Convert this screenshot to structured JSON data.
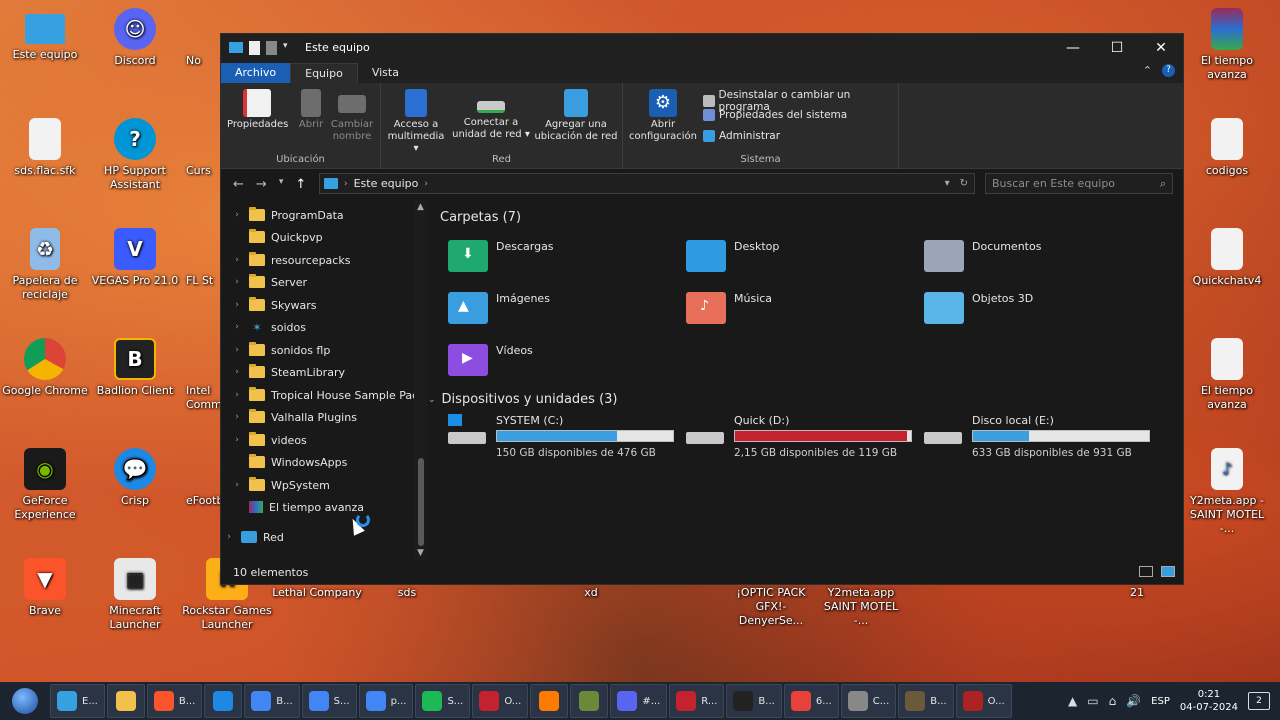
{
  "desktop": {
    "left_icons": [
      {
        "label": "Este equipo",
        "icon": "monitor-icon",
        "color": "#35a1e0"
      },
      {
        "label": "Discord",
        "icon": "discord-icon",
        "color": "#5865f2"
      },
      {
        "label": "sds.flac.sfk",
        "icon": "file-icon",
        "color": "#f2f2f2"
      },
      {
        "label": "HP Support Assistant",
        "icon": "help-icon",
        "color": "#0096d6"
      },
      {
        "label": "Papelera de reciclaje",
        "icon": "recycle-bin-icon",
        "color": "#8fbbe8"
      },
      {
        "label": "VEGAS Pro 21.0",
        "icon": "vegas-icon",
        "color": "#3a5cff"
      },
      {
        "label": "Google Chrome",
        "icon": "chrome-icon",
        "color": "#4285f4"
      },
      {
        "label": "Badlion Client",
        "icon": "badlion-icon",
        "color": "#222"
      },
      {
        "label": "GeForce Experience",
        "icon": "nvidia-icon",
        "color": "#76b900"
      },
      {
        "label": "Crisp",
        "icon": "crisp-icon",
        "color": "#1e88e5"
      },
      {
        "label": "Brave",
        "icon": "brave-icon",
        "color": "#fb542b"
      },
      {
        "label": "Minecraft Launcher",
        "icon": "minecraft-icon",
        "color": "#e8e8e8"
      },
      {
        "label": "Rockstar Games Launcher",
        "icon": "rockstar-icon",
        "color": "#fcaf17"
      },
      {
        "label": "Lethal Company",
        "icon": "game-icon",
        "color": "#6a1d1d"
      },
      {
        "label": "sds",
        "icon": "m4a-file-icon",
        "color": "#f2f2f2"
      },
      {
        "label": "xd",
        "icon": "m4a-file-icon",
        "color": "#f2f2f2"
      },
      {
        "label": "¡OPTIC PACK GFX!-DenyerSe...",
        "icon": "folder-icon",
        "color": "#f0c14b"
      },
      {
        "label": "Y2meta.app SAINT MOTEL -...",
        "icon": "file-icon",
        "color": "#f2f2f2"
      },
      {
        "label": "21",
        "icon": "m4a-file-icon",
        "color": "#f2f2f2"
      }
    ],
    "right_icons": [
      {
        "label": "El tiempo avanza",
        "icon": "winrar-icon",
        "color": "#9b2a5a"
      },
      {
        "label": "codigos",
        "icon": "file-icon",
        "color": "#f2f2f2"
      },
      {
        "label": "Quickchatv4",
        "icon": "file-icon",
        "color": "#f2f2f2"
      },
      {
        "label": "El tiempo avanza",
        "icon": "file-icon",
        "color": "#f2f2f2"
      },
      {
        "label": "Y2meta.app - SAINT MOTEL -...",
        "icon": "mp3-file-icon",
        "color": "#f2f2f2"
      }
    ],
    "partial_labels": [
      "No",
      "Curs",
      "FL St",
      "Intel Comm",
      "eFootb"
    ]
  },
  "window": {
    "title": "Este equipo",
    "tabs": [
      "Archivo",
      "Equipo",
      "Vista"
    ],
    "ribbon": {
      "ubicacion": {
        "label": "Ubicación",
        "buttons": [
          "Propiedades",
          "Abrir",
          "Cambiar nombre"
        ]
      },
      "red": {
        "label": "Red",
        "buttons": [
          "Acceso a multimedia ▾",
          "Conectar a unidad de red ▾",
          "Agregar una ubicación de red"
        ]
      },
      "sistema": {
        "label": "Sistema",
        "open_config": "Abrir configuración",
        "items": [
          "Desinstalar o cambiar un programa",
          "Propiedades del sistema",
          "Administrar"
        ]
      }
    },
    "address": "Este equipo",
    "search_placeholder": "Buscar en Este equipo",
    "tree": [
      "ProgramData",
      "Quickpvp",
      "resourcepacks",
      "Server",
      "Skywars",
      "soidos",
      "sonidos flp",
      "SteamLibrary",
      "Tropical House Sample Pack",
      "Valhalla Plugins",
      "videos",
      "WindowsApps",
      "WpSystem",
      "El tiempo avanza"
    ],
    "tree_network": "Red",
    "folders_header": "Carpetas (7)",
    "folders": [
      {
        "name": "Descargas",
        "color": "#1fa971"
      },
      {
        "name": "Desktop",
        "color": "#2e9be0"
      },
      {
        "name": "Documentos",
        "color": "#9aa6b8"
      },
      {
        "name": "Imágenes",
        "color": "#3a9de0"
      },
      {
        "name": "Música",
        "color": "#e8705a"
      },
      {
        "name": "Objetos 3D",
        "color": "#5ab5e8"
      },
      {
        "name": "Vídeos",
        "color": "#8d4de0"
      }
    ],
    "devices_header": "Dispositivos y unidades (3)",
    "drives": [
      {
        "name": "SYSTEM (C:)",
        "free": "150 GB disponibles de 476 GB",
        "used_fraction": 0.68,
        "bar_color": "#3a9ee0"
      },
      {
        "name": "Quick (D:)",
        "free": "2,15 GB disponibles de 119 GB",
        "used_fraction": 0.98,
        "bar_color": "#c4222f"
      },
      {
        "name": "Disco local (E:)",
        "free": "633 GB disponibles de 931 GB",
        "used_fraction": 0.32,
        "bar_color": "#3a9ee0"
      }
    ],
    "status": "10 elementos"
  },
  "taskbar": {
    "items": [
      "E...",
      "",
      "B...",
      "",
      "B...",
      "S...",
      "p...",
      "S...",
      "O...",
      "",
      "",
      "#...",
      "R...",
      "B...",
      "6...",
      "C...",
      "B...",
      "O..."
    ],
    "language": "ESP",
    "time": "0:21",
    "date": "04-07-2024",
    "notifications": "2"
  }
}
